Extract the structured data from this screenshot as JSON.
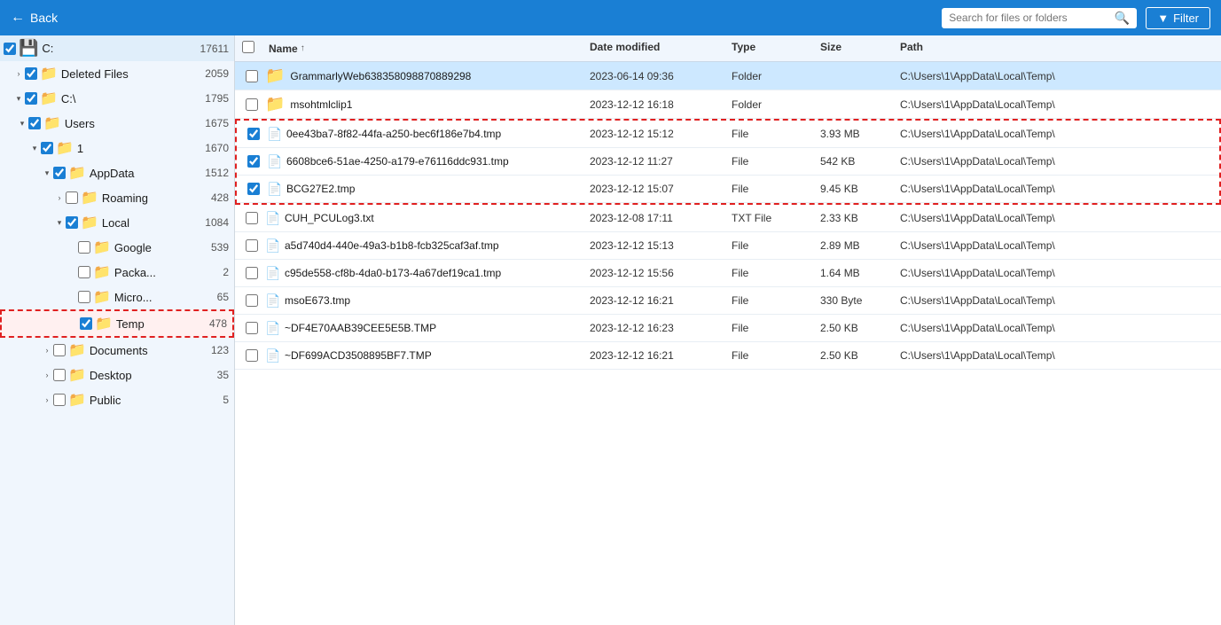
{
  "toolbar": {
    "back_label": "Back",
    "search_placeholder": "Search for files or folders",
    "filter_label": "Filter"
  },
  "sidebar": {
    "drive": {
      "label": "C:",
      "count": "17611"
    },
    "items": [
      {
        "id": "deleted-files",
        "label": "Deleted Files",
        "count": "2059",
        "indent": 1,
        "expanded": false,
        "checked": true,
        "type": "folder",
        "color": "yellow"
      },
      {
        "id": "c-root",
        "label": "C:\\",
        "count": "1795",
        "indent": 1,
        "expanded": true,
        "checked": true,
        "type": "folder",
        "color": "yellow"
      },
      {
        "id": "users",
        "label": "Users",
        "count": "1675",
        "indent": 2,
        "expanded": true,
        "checked": true,
        "type": "folder",
        "color": "yellow"
      },
      {
        "id": "user-1",
        "label": "1",
        "count": "1670",
        "indent": 3,
        "expanded": true,
        "checked": true,
        "type": "folder",
        "color": "yellow"
      },
      {
        "id": "appdata",
        "label": "AppData",
        "count": "1512",
        "indent": 4,
        "expanded": true,
        "checked": true,
        "type": "folder",
        "color": "yellow"
      },
      {
        "id": "roaming",
        "label": "Roaming",
        "count": "428",
        "indent": 5,
        "expanded": false,
        "checked": false,
        "type": "folder",
        "color": "yellow"
      },
      {
        "id": "local",
        "label": "Local",
        "count": "1084",
        "indent": 5,
        "expanded": true,
        "checked": true,
        "type": "folder",
        "color": "yellow"
      },
      {
        "id": "google",
        "label": "Google",
        "count": "539",
        "indent": 6,
        "expanded": false,
        "checked": false,
        "type": "folder",
        "color": "yellow"
      },
      {
        "id": "packa",
        "label": "Packa...",
        "count": "2",
        "indent": 6,
        "expanded": false,
        "checked": false,
        "type": "folder",
        "color": "yellow"
      },
      {
        "id": "micro",
        "label": "Micro...",
        "count": "65",
        "indent": 6,
        "expanded": false,
        "checked": false,
        "type": "folder",
        "color": "yellow"
      },
      {
        "id": "temp",
        "label": "Temp",
        "count": "478",
        "indent": 6,
        "expanded": false,
        "checked": true,
        "type": "folder",
        "color": "blue",
        "highlighted": true
      },
      {
        "id": "documents",
        "label": "Documents",
        "count": "123",
        "indent": 4,
        "expanded": false,
        "checked": false,
        "type": "folder",
        "color": "yellow"
      },
      {
        "id": "desktop",
        "label": "Desktop",
        "count": "35",
        "indent": 4,
        "expanded": false,
        "checked": false,
        "type": "folder",
        "color": "yellow"
      },
      {
        "id": "public",
        "label": "Public",
        "count": "5",
        "indent": 4,
        "expanded": false,
        "checked": false,
        "type": "folder",
        "color": "yellow"
      }
    ]
  },
  "table": {
    "columns": [
      "",
      "Name",
      "Date modified",
      "Type",
      "Size",
      "Path"
    ],
    "rows": [
      {
        "id": "row-grammarly",
        "name": "GrammarlyWeb638358098870889298",
        "date": "2023-06-14 09:36",
        "type": "Folder",
        "size": "",
        "path": "C:\\Users\\1\\AppData\\Local\\Temp\\",
        "checked": false,
        "is_folder": true,
        "selected": true,
        "dashed": false
      },
      {
        "id": "row-mso",
        "name": "msohtmlclip1",
        "date": "2023-12-12 16:18",
        "type": "Folder",
        "size": "",
        "path": "C:\\Users\\1\\AppData\\Local\\Temp\\",
        "checked": false,
        "is_folder": true,
        "selected": false,
        "dashed": false
      },
      {
        "id": "row-0ee",
        "name": "0ee43ba7-8f82-44fa-a250-bec6f186e7b4.tmp",
        "date": "2023-12-12 15:12",
        "type": "File",
        "size": "3.93 MB",
        "path": "C:\\Users\\1\\AppData\\Local\\Temp\\",
        "checked": true,
        "is_folder": false,
        "selected": false,
        "dashed": true
      },
      {
        "id": "row-6608",
        "name": "6608bce6-51ae-4250-a179-e76116ddc931.tmp",
        "date": "2023-12-12 11:27",
        "type": "File",
        "size": "542 KB",
        "path": "C:\\Users\\1\\AppData\\Local\\Temp\\",
        "checked": true,
        "is_folder": false,
        "selected": false,
        "dashed": true
      },
      {
        "id": "row-bcg",
        "name": "BCG27E2.tmp",
        "date": "2023-12-12 15:07",
        "type": "File",
        "size": "9.45 KB",
        "path": "C:\\Users\\1\\AppData\\Local\\Temp\\",
        "checked": true,
        "is_folder": false,
        "selected": false,
        "dashed": true
      },
      {
        "id": "row-cuh",
        "name": "CUH_PCULog3.txt",
        "date": "2023-12-08 17:11",
        "type": "TXT File",
        "size": "2.33 KB",
        "path": "C:\\Users\\1\\AppData\\Local\\Temp\\",
        "checked": false,
        "is_folder": false,
        "selected": false,
        "dashed": false
      },
      {
        "id": "row-a5d",
        "name": "a5d740d4-440e-49a3-b1b8-fcb325caf3af.tmp",
        "date": "2023-12-12 15:13",
        "type": "File",
        "size": "2.89 MB",
        "path": "C:\\Users\\1\\AppData\\Local\\Temp\\",
        "checked": false,
        "is_folder": false,
        "selected": false,
        "dashed": false
      },
      {
        "id": "row-c95",
        "name": "c95de558-cf8b-4da0-b173-4a67def19ca1.tmp",
        "date": "2023-12-12 15:56",
        "type": "File",
        "size": "1.64 MB",
        "path": "C:\\Users\\1\\AppData\\Local\\Temp\\",
        "checked": false,
        "is_folder": false,
        "selected": false,
        "dashed": false
      },
      {
        "id": "row-msoe",
        "name": "msoE673.tmp",
        "date": "2023-12-12 16:21",
        "type": "File",
        "size": "330 Byte",
        "path": "C:\\Users\\1\\AppData\\Local\\Temp\\",
        "checked": false,
        "is_folder": false,
        "selected": false,
        "dashed": false
      },
      {
        "id": "row-df4e",
        "name": "~DF4E70AAB39CEE5E5B.TMP",
        "date": "2023-12-12 16:23",
        "type": "File",
        "size": "2.50 KB",
        "path": "C:\\Users\\1\\AppData\\Local\\Temp\\",
        "checked": false,
        "is_folder": false,
        "selected": false,
        "dashed": false
      },
      {
        "id": "row-df699",
        "name": "~DF699ACD3508895BF7.TMP",
        "date": "2023-12-12 16:21",
        "type": "File",
        "size": "2.50 KB",
        "path": "C:\\Users\\1\\AppData\\Local\\Temp\\",
        "checked": false,
        "is_folder": false,
        "selected": false,
        "dashed": false
      }
    ]
  }
}
